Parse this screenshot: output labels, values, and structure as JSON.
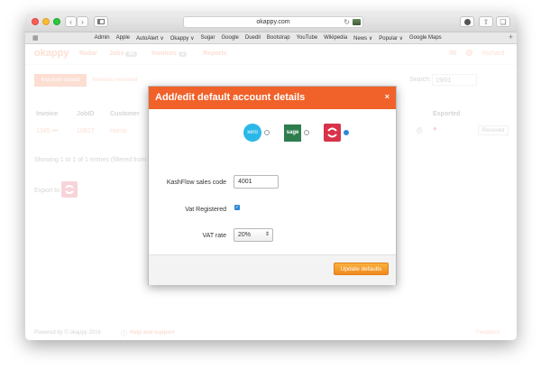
{
  "browser": {
    "url": "okappy.com",
    "bookmarks": [
      "Admin",
      "Apple",
      "AutoAlert ∨",
      "Okappy ∨",
      "Sugar",
      "Google",
      "Duedil",
      "Bootstrap",
      "YouTube",
      "Wikipedia",
      "News ∨",
      "Popular ∨",
      "Google Maps"
    ]
  },
  "app": {
    "logo": "okappy",
    "nav": {
      "radar": "Radar",
      "jobs": "Jobs",
      "jobs_count": "46",
      "invoices": "Invoices",
      "invoices_count": "1",
      "reports": "Reports"
    },
    "user": "Richard",
    "tabs": {
      "invoices_raised": "Invoices raised",
      "invoices_received": "Invoices received"
    },
    "search_label": "Search:",
    "search_value": "19/01",
    "table": {
      "headers": {
        "invoice": "Invoice",
        "jobid": "JobID",
        "customer": "Customer",
        "exported": "Exported"
      },
      "row": {
        "invoice": "1345 •••",
        "jobid": "10827",
        "customer": "Harris",
        "status": "Received"
      }
    },
    "showing": "Showing 1 to 1 of 1 entries (filtered from",
    "export_to": "Export to",
    "footer_left": "Powered by © okappy 2016",
    "footer_help": "Help and support",
    "footer_right": "Feedback"
  },
  "modal": {
    "title": "Add/edit default account details",
    "close": "×",
    "providers": [
      {
        "name": "xero",
        "label": "xero",
        "selected": false
      },
      {
        "name": "sage",
        "label": "sage",
        "selected": false
      },
      {
        "name": "kashflow",
        "label": "",
        "selected": true
      }
    ],
    "sales_code_label": "KashFlow sales code",
    "sales_code_value": "4001",
    "vat_registered_label": "Vat Registered",
    "vat_registered_checked": true,
    "vat_rate_label": "VAT rate",
    "vat_rate_value": "20%",
    "update_button": "Update defaults"
  },
  "colors": {
    "brand": "#f0622a",
    "kashflow": "#d8334a",
    "xero": "#2bb8e8",
    "sage": "#2e7d4f",
    "button": "#f29b2b"
  }
}
